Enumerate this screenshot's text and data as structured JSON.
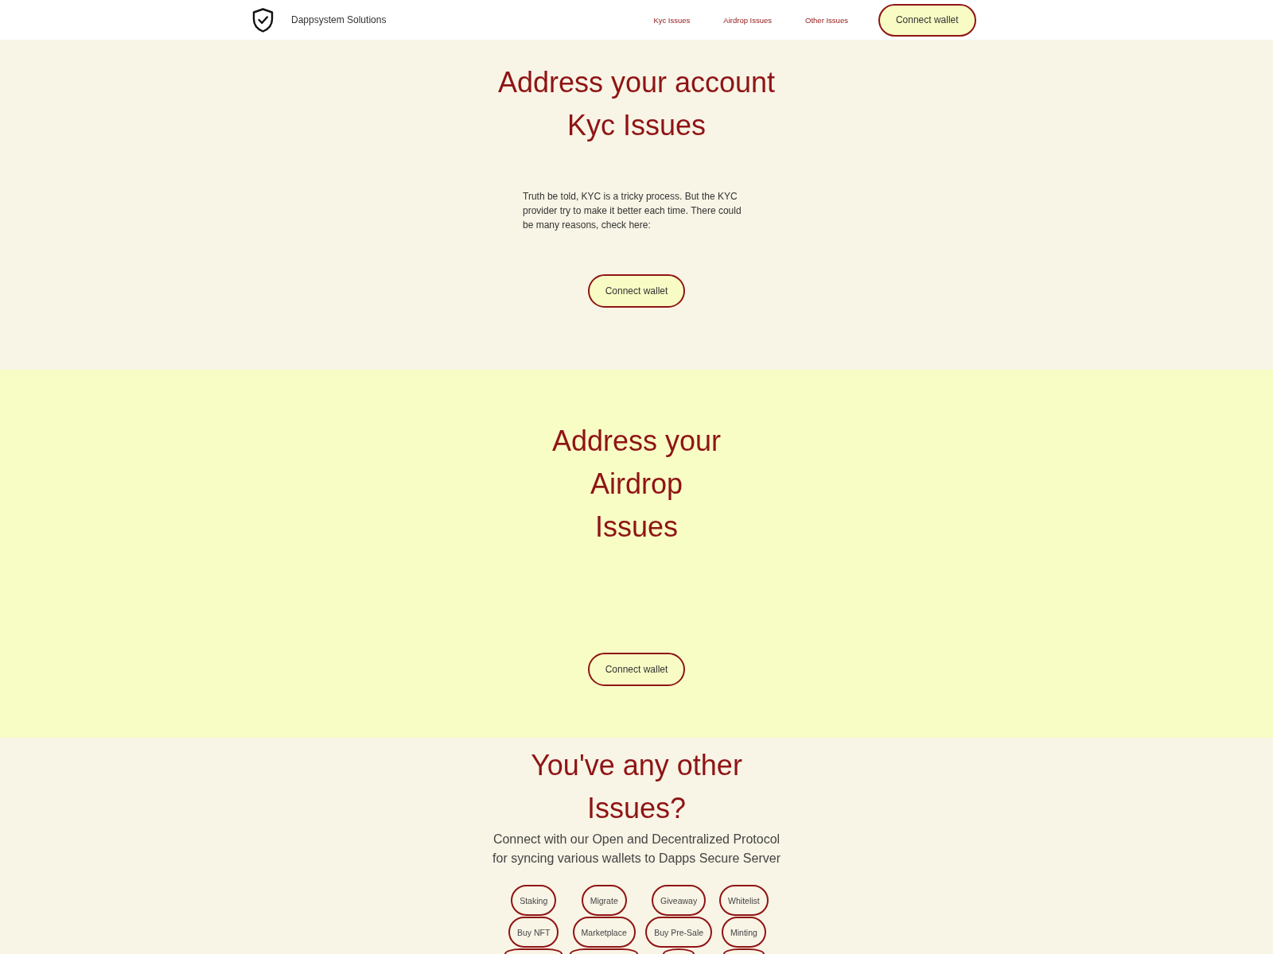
{
  "header": {
    "brand": "Dappsystem Solutions",
    "nav": [
      "Kyc Issues",
      "Airdrop Issues",
      "Other Issues"
    ],
    "button": "Connect wallet"
  },
  "kyc_section": {
    "heading_lines": [
      "Address your account",
      "Kyc Issues"
    ],
    "text": "Truth be told, KYC is a tricky process. But the KYC provider try to make it better each time. There could be many reasons, check here:",
    "button": "Connect wallet"
  },
  "airdrop_section": {
    "heading_lines": [
      "Address your",
      "Airdrop",
      "Issues"
    ],
    "button": "Connect wallet"
  },
  "other_section": {
    "heading_lines": [
      "You've any other",
      "Issues?"
    ],
    "subtitle": "Connect with our Open and Decentralized Protocol for syncing various wallets to Dapps Secure Server",
    "buttons": [
      {
        "kind": "full",
        "label": "Staking"
      },
      {
        "kind": "full",
        "label": "Migrate"
      },
      {
        "kind": "full",
        "label": "Giveaway"
      },
      {
        "kind": "full",
        "label": "Whitelist"
      },
      {
        "kind": "full",
        "label": "Buy NFT"
      },
      {
        "kind": "full",
        "label": "Marketplace"
      },
      {
        "kind": "full",
        "label": "Buy Pre-Sale"
      },
      {
        "kind": "full",
        "label": "Minting"
      },
      {
        "kind": "cut-off"
      },
      {
        "kind": "cut-off"
      },
      {
        "kind": "cut-off"
      },
      {
        "kind": "cut-off"
      }
    ]
  }
}
